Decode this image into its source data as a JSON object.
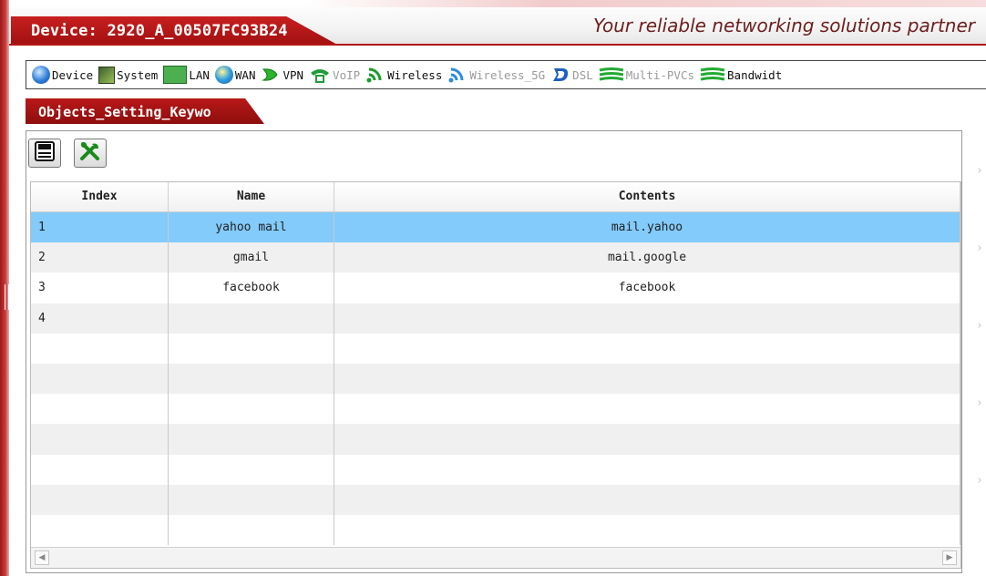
{
  "header": {
    "device_title": "Device: 2920_A_00507FC93B24",
    "tagline": "Your reliable networking solutions partner"
  },
  "toolbar": {
    "items": [
      {
        "label": "Device",
        "icon": "globe-icon",
        "enabled": true
      },
      {
        "label": "System",
        "icon": "system-icon",
        "enabled": true
      },
      {
        "label": "LAN",
        "icon": "lan-icon",
        "enabled": true
      },
      {
        "label": "WAN",
        "icon": "wan-icon",
        "enabled": true
      },
      {
        "label": "VPN",
        "icon": "vpn-icon",
        "enabled": true
      },
      {
        "label": "VoIP",
        "icon": "voip-icon",
        "enabled": false
      },
      {
        "label": "Wireless",
        "icon": "wireless-icon",
        "enabled": true
      },
      {
        "label": "Wireless_5G",
        "icon": "wireless-5g-icon",
        "enabled": false
      },
      {
        "label": "DSL",
        "icon": "dsl-icon",
        "enabled": false
      },
      {
        "label": "Multi-PVCs",
        "icon": "multi-pvcs-icon",
        "enabled": false
      },
      {
        "label": "Bandwidt",
        "icon": "bandwidth-icon",
        "enabled": true
      }
    ]
  },
  "section": {
    "title": "Objects_Setting_Keywo"
  },
  "panel": {
    "buttons": [
      {
        "icon": "save-icon"
      },
      {
        "icon": "tools-icon"
      }
    ]
  },
  "table": {
    "columns": [
      "Index",
      "Name",
      "Contents"
    ],
    "rows": [
      {
        "index": "1",
        "name": "yahoo mail",
        "contents": "mail.yahoo",
        "selected": true
      },
      {
        "index": "2",
        "name": "gmail",
        "contents": "mail.google",
        "selected": false
      },
      {
        "index": "3",
        "name": "facebook",
        "contents": "facebook",
        "selected": false
      },
      {
        "index": "4",
        "name": "",
        "contents": "",
        "selected": false
      },
      {
        "index": "",
        "name": "",
        "contents": "",
        "selected": false
      },
      {
        "index": "",
        "name": "",
        "contents": "",
        "selected": false
      },
      {
        "index": "",
        "name": "",
        "contents": "",
        "selected": false
      },
      {
        "index": "",
        "name": "",
        "contents": "",
        "selected": false
      },
      {
        "index": "",
        "name": "",
        "contents": "",
        "selected": false
      },
      {
        "index": "",
        "name": "",
        "contents": "",
        "selected": false
      },
      {
        "index": "",
        "name": "",
        "contents": "",
        "selected": false
      }
    ]
  },
  "colors": {
    "brand_red": "#b81818",
    "selected_row": "#82cbfb"
  }
}
